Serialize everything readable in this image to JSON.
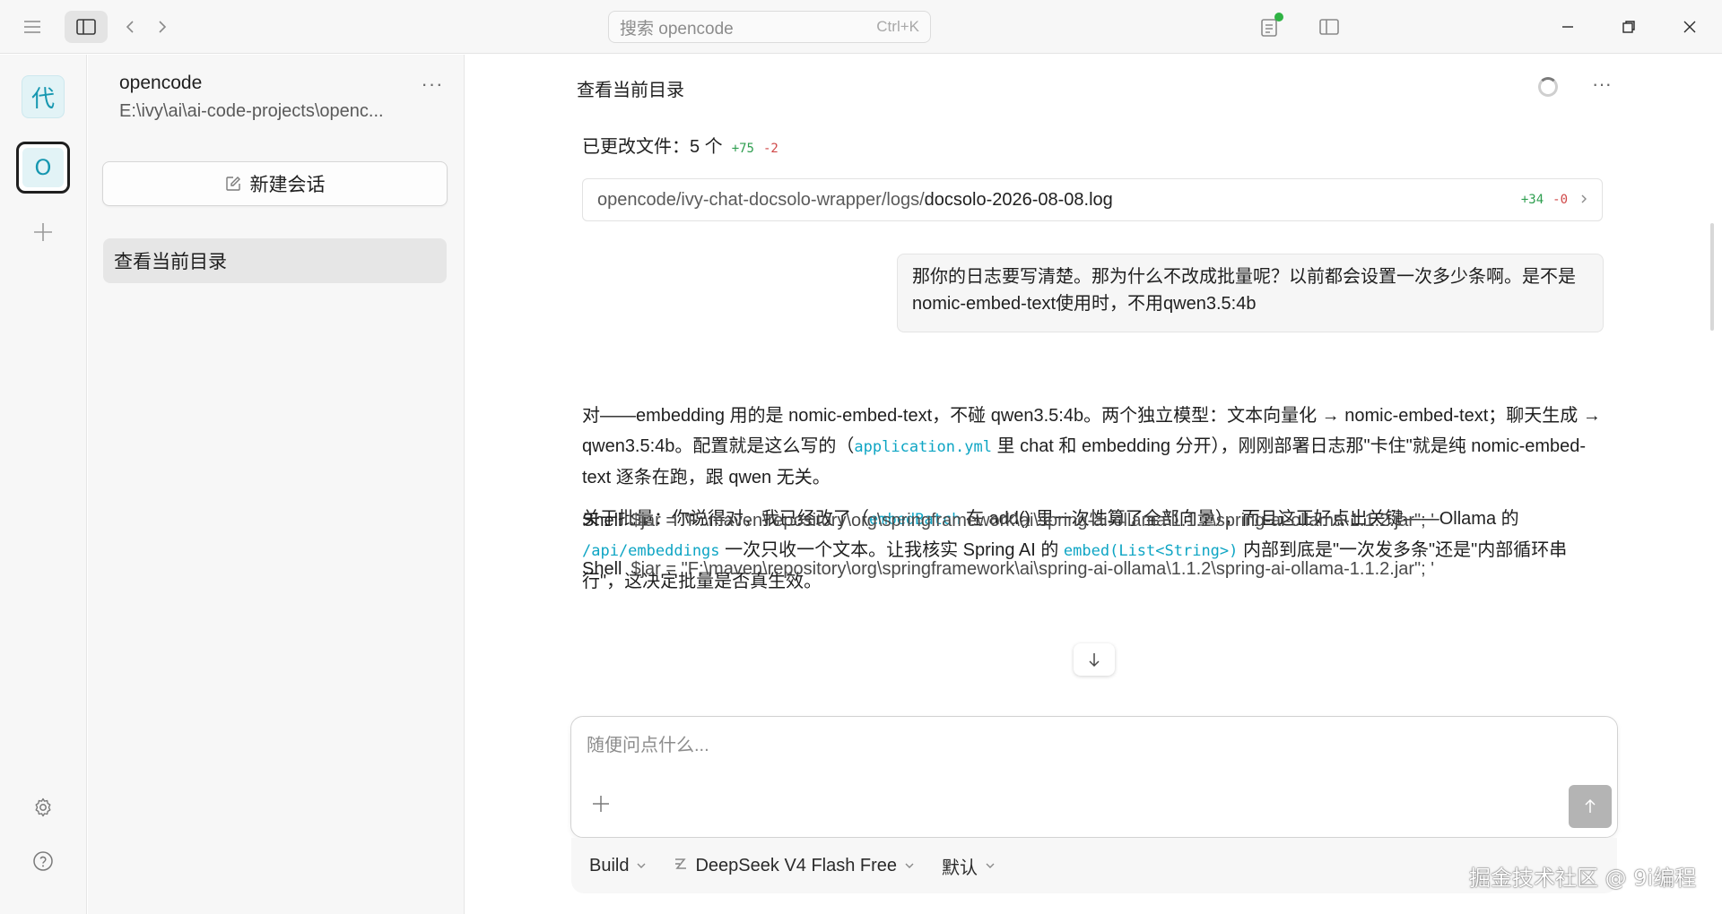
{
  "titlebar": {
    "search_placeholder": "搜索 opencode",
    "search_shortcut": "Ctrl+K"
  },
  "rail": {
    "projects": [
      {
        "initial": "代"
      },
      {
        "initial": "O"
      }
    ]
  },
  "sidebar": {
    "project_name": "opencode",
    "project_path": "E:\\ivy\\ai\\ai-code-projects\\openc...",
    "more": "···",
    "new_session_label": "新建会话",
    "sessions": [
      {
        "title": "查看当前目录"
      }
    ]
  },
  "chat": {
    "title": "查看当前目录",
    "more": "···",
    "changed_files_label": "已更改文件：5 个",
    "changed_added": "+75",
    "changed_removed": "-2",
    "file": {
      "dir": "opencode/ivy-chat-docsolo-wrapper/logs/",
      "name": "docsolo-2026-08-08.log",
      "added": "+34",
      "removed": "-0"
    },
    "user_message": "那你的日志要写清楚。那为什么不改成批量呢？以前都会设置一次多少条啊。是不是nomic-embed-text使用时，不用qwen3.5:4b",
    "answer": {
      "p1_a": "对——embedding 用的是 nomic-embed-text，不碰 qwen3.5:4b。两个独立模型：文本向量化 → nomic-embed-text；聊天生成 → qwen3.5:4b。配置就是这么写的（",
      "p1_code": "application.yml",
      "p1_b": " 里 chat 和 embedding 分开），刚刚部署日志那\"卡住\"就是纯 nomic-embed-text 逐条在跑，跟 qwen 无关。",
      "p2_a": "关于批量：你说得对，我已经改了（",
      "p2_code1": "embedBatch",
      "p2_b": " 在 add() 里一次性算了全部向量），而且这正好点出关键——Ollama 的 ",
      "p2_code2": "/api/embeddings",
      "p2_c": " 一次只收一个文本。让我核实 Spring AI 的 ",
      "p2_code3": "embed(List<String>)",
      "p2_d": " 内部到底是\"一次发多条\"还是\"内部循环串行\"，这决定批量是否真生效。"
    },
    "shell_tag": "Shell",
    "shell_cmd_1": "$jar = \"F:\\maven\\repository\\org\\springframework\\ai\\spring-ai-ollama\\1.1.2\\spring-ai-ollama-1.1.2.jar\"; '",
    "shell_cmd_2": "$jar = \"F:\\maven\\repository\\org\\springframework\\ai\\spring-ai-ollama\\1.1.2\\spring-ai-ollama-1.1.2.jar\"; '"
  },
  "composer": {
    "placeholder": "随便问点什么...",
    "agent": "Build",
    "model": "DeepSeek V4 Flash Free",
    "variant": "默认"
  },
  "watermark": "掘金技术社区 @ 9i编程"
}
